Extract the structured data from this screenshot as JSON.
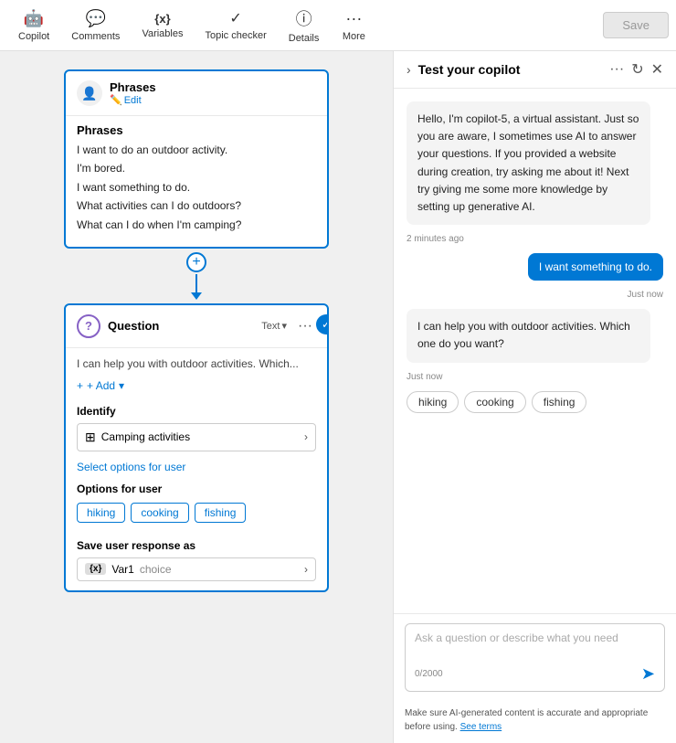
{
  "toolbar": {
    "items": [
      {
        "id": "copilot",
        "label": "Copilot",
        "icon": "🤖"
      },
      {
        "id": "comments",
        "label": "Comments",
        "icon": "💬"
      },
      {
        "id": "variables",
        "label": "Variables",
        "icon": "{x}"
      },
      {
        "id": "topic-checker",
        "label": "Topic checker",
        "icon": "✓"
      },
      {
        "id": "details",
        "label": "Details",
        "icon": "ⓘ"
      },
      {
        "id": "more",
        "label": "More",
        "icon": "···"
      }
    ],
    "save_label": "Save"
  },
  "phrases_card": {
    "title": "Phrases",
    "edit_label": "Edit",
    "body_label": "Phrases",
    "phrases": [
      "I want to do an outdoor activity.",
      "I'm bored.",
      "I want something to do.",
      "What activities can I do outdoors?",
      "What can I do when I'm camping?"
    ]
  },
  "question_card": {
    "title": "Question",
    "badge": "Text",
    "preview": "I can help you with outdoor activities. Which...",
    "add_label": "+ Add",
    "identify_label": "Identify",
    "identify_value": "Camping activities",
    "select_options_label": "Select options for user",
    "options_label": "Options for user",
    "options": [
      "hiking",
      "cooking",
      "fishing"
    ],
    "save_label": "Save user response as",
    "var_name": "Var1",
    "var_type": "choice"
  },
  "test_panel": {
    "title": "Test your copilot",
    "messages": [
      {
        "type": "bot",
        "text": "Hello, I'm copilot-5, a virtual assistant. Just so you are aware, I sometimes use AI to answer your questions. If you provided a website during creation, try asking me about it! Next try giving me some more knowledge by setting up generative AI.",
        "time": "2 minutes ago"
      },
      {
        "type": "user",
        "text": "I want something to do.",
        "time": "Just now"
      },
      {
        "type": "bot",
        "text": "I can help you with outdoor activities. Which one do you want?",
        "time": "Just now"
      }
    ],
    "quick_replies": [
      "hiking",
      "cooking",
      "fishing"
    ],
    "input_placeholder": "Ask a question or describe what you need",
    "char_count": "0/2000",
    "disclaimer": "Make sure AI-generated content is accurate and appropriate before using.",
    "disclaimer_link": "See terms"
  }
}
